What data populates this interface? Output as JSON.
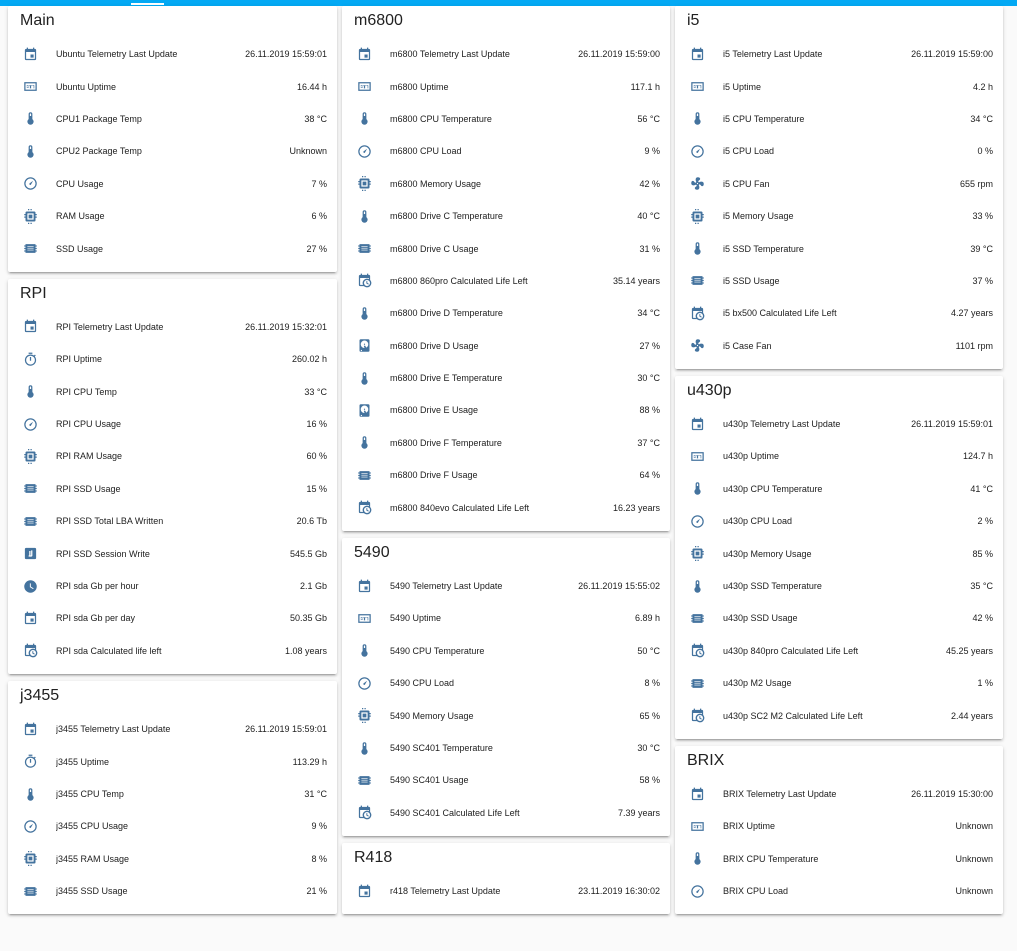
{
  "colors": {
    "accent": "#03a9f4",
    "icon": "#44739e"
  },
  "columns": [
    [
      {
        "title": "Main",
        "rows": [
          {
            "icon": "calendar",
            "label": "Ubuntu Telemetry Last Update",
            "value": "26.11.2019 15:59:01"
          },
          {
            "icon": "timer-box",
            "label": "Ubuntu Uptime",
            "value": "16.44 h"
          },
          {
            "icon": "thermometer",
            "label": "CPU1 Package Temp",
            "value": "38 °C"
          },
          {
            "icon": "thermometer",
            "label": "CPU2 Package Temp",
            "value": "Unknown"
          },
          {
            "icon": "gauge",
            "label": "CPU Usage",
            "value": "7 %"
          },
          {
            "icon": "chip",
            "label": "RAM Usage",
            "value": "6 %"
          },
          {
            "icon": "memory",
            "label": "SSD Usage",
            "value": "27 %"
          }
        ]
      },
      {
        "title": "RPI",
        "rows": [
          {
            "icon": "calendar",
            "label": "RPI Telemetry Last Update",
            "value": "26.11.2019 15:32:01"
          },
          {
            "icon": "timer",
            "label": "RPI Uptime",
            "value": "260.02 h"
          },
          {
            "icon": "thermometer",
            "label": "RPI CPU Temp",
            "value": "33 °C"
          },
          {
            "icon": "gauge",
            "label": "RPI CPU Usage",
            "value": "16 %"
          },
          {
            "icon": "chip",
            "label": "RPI RAM Usage",
            "value": "60 %"
          },
          {
            "icon": "memory",
            "label": "RPI SSD Usage",
            "value": "15 %"
          },
          {
            "icon": "memory",
            "label": "RPI SSD Total LBA Written",
            "value": "20.6 Tb"
          },
          {
            "icon": "alpha-w-box",
            "label": "RPI SSD Session Write",
            "value": "545.5 Gb"
          },
          {
            "icon": "clock",
            "label": "RPI sda Gb per hour",
            "value": "2.1 Gb"
          },
          {
            "icon": "calendar",
            "label": "RPI sda Gb per day",
            "value": "50.35 Gb"
          },
          {
            "icon": "calendar-clock",
            "label": "RPI sda Calculated life left",
            "value": "1.08 years"
          }
        ]
      },
      {
        "title": "j3455",
        "rows": [
          {
            "icon": "calendar",
            "label": "j3455 Telemetry Last Update",
            "value": "26.11.2019 15:59:01"
          },
          {
            "icon": "timer",
            "label": "j3455 Uptime",
            "value": "113.29 h"
          },
          {
            "icon": "thermometer",
            "label": "j3455 CPU Temp",
            "value": "31 °C"
          },
          {
            "icon": "gauge",
            "label": "j3455 CPU Usage",
            "value": "9 %"
          },
          {
            "icon": "chip",
            "label": "j3455 RAM Usage",
            "value": "8 %"
          },
          {
            "icon": "memory",
            "label": "j3455 SSD Usage",
            "value": "21 %"
          }
        ]
      }
    ],
    [
      {
        "title": "m6800",
        "rows": [
          {
            "icon": "calendar",
            "label": "m6800 Telemetry Last Update",
            "value": "26.11.2019 15:59:00"
          },
          {
            "icon": "timer-box",
            "label": "m6800 Uptime",
            "value": "117.1 h"
          },
          {
            "icon": "thermometer",
            "label": "m6800 CPU Temperature",
            "value": "56 °C"
          },
          {
            "icon": "gauge",
            "label": "m6800 CPU Load",
            "value": "9 %"
          },
          {
            "icon": "chip",
            "label": "m6800 Memory Usage",
            "value": "42 %"
          },
          {
            "icon": "thermometer",
            "label": "m6800 Drive C Temperature",
            "value": "40 °C"
          },
          {
            "icon": "memory",
            "label": "m6800 Drive C Usage",
            "value": "31 %"
          },
          {
            "icon": "calendar-clock",
            "label": "m6800 860pro Calculated Life Left",
            "value": "35.14 years"
          },
          {
            "icon": "thermometer",
            "label": "m6800 Drive D Temperature",
            "value": "34 °C"
          },
          {
            "icon": "harddisk",
            "label": "m6800 Drive D Usage",
            "value": "27 %"
          },
          {
            "icon": "thermometer",
            "label": "m6800 Drive E Temperature",
            "value": "30 °C"
          },
          {
            "icon": "harddisk",
            "label": "m6800 Drive E Usage",
            "value": "88 %"
          },
          {
            "icon": "thermometer",
            "label": "m6800 Drive F Temperature",
            "value": "37 °C"
          },
          {
            "icon": "memory",
            "label": "m6800 Drive F Usage",
            "value": "64 %"
          },
          {
            "icon": "calendar-clock",
            "label": "m6800 840evo Calculated Life Left",
            "value": "16.23 years"
          }
        ]
      },
      {
        "title": "5490",
        "rows": [
          {
            "icon": "calendar",
            "label": "5490 Telemetry Last Update",
            "value": "26.11.2019 15:55:02"
          },
          {
            "icon": "timer-box",
            "label": "5490 Uptime",
            "value": "6.89 h"
          },
          {
            "icon": "thermometer",
            "label": "5490 CPU Temperature",
            "value": "50 °C"
          },
          {
            "icon": "gauge",
            "label": "5490 CPU Load",
            "value": "8 %"
          },
          {
            "icon": "chip",
            "label": "5490 Memory Usage",
            "value": "65 %"
          },
          {
            "icon": "thermometer",
            "label": "5490 SC401 Temperature",
            "value": "30 °C"
          },
          {
            "icon": "memory",
            "label": "5490 SC401 Usage",
            "value": "58 %"
          },
          {
            "icon": "calendar-clock",
            "label": "5490 SC401 Calculated Life Left",
            "value": "7.39 years"
          }
        ]
      },
      {
        "title": "R418",
        "rows": [
          {
            "icon": "calendar",
            "label": "r418 Telemetry Last Update",
            "value": "23.11.2019 16:30:02"
          }
        ]
      }
    ],
    [
      {
        "title": "i5",
        "rows": [
          {
            "icon": "calendar",
            "label": "i5 Telemetry Last Update",
            "value": "26.11.2019 15:59:00"
          },
          {
            "icon": "timer-box",
            "label": "i5 Uptime",
            "value": "4.2 h"
          },
          {
            "icon": "thermometer",
            "label": "i5 CPU Temperature",
            "value": "34 °C"
          },
          {
            "icon": "gauge",
            "label": "i5 CPU Load",
            "value": "0 %"
          },
          {
            "icon": "fan",
            "label": "i5 CPU Fan",
            "value": "655 rpm"
          },
          {
            "icon": "chip",
            "label": "i5 Memory Usage",
            "value": "33 %"
          },
          {
            "icon": "thermometer",
            "label": "i5 SSD Temperature",
            "value": "39 °C"
          },
          {
            "icon": "memory",
            "label": "i5 SSD Usage",
            "value": "37 %"
          },
          {
            "icon": "calendar-clock",
            "label": "i5 bx500 Calculated Life Left",
            "value": "4.27 years"
          },
          {
            "icon": "fan",
            "label": "i5 Case Fan",
            "value": "1101 rpm"
          }
        ]
      },
      {
        "title": "u430p",
        "rows": [
          {
            "icon": "calendar",
            "label": "u430p Telemetry Last Update",
            "value": "26.11.2019 15:59:01"
          },
          {
            "icon": "timer-box",
            "label": "u430p Uptime",
            "value": "124.7 h"
          },
          {
            "icon": "thermometer",
            "label": "u430p CPU Temperature",
            "value": "41 °C"
          },
          {
            "icon": "gauge",
            "label": "u430p CPU Load",
            "value": "2 %"
          },
          {
            "icon": "chip",
            "label": "u430p Memory Usage",
            "value": "85 %"
          },
          {
            "icon": "thermometer",
            "label": "u430p SSD Temperature",
            "value": "35 °C"
          },
          {
            "icon": "memory",
            "label": "u430p SSD Usage",
            "value": "42 %"
          },
          {
            "icon": "calendar-clock",
            "label": "u430p 840pro Calculated Life Left",
            "value": "45.25 years"
          },
          {
            "icon": "memory",
            "label": "u430p M2 Usage",
            "value": "1 %"
          },
          {
            "icon": "calendar-clock",
            "label": "u430p SC2 M2 Calculated Life Left",
            "value": "2.44 years"
          }
        ]
      },
      {
        "title": "BRIX",
        "rows": [
          {
            "icon": "calendar",
            "label": "BRIX Telemetry Last Update",
            "value": "26.11.2019 15:30:00"
          },
          {
            "icon": "timer-box",
            "label": "BRIX Uptime",
            "value": "Unknown"
          },
          {
            "icon": "thermometer",
            "label": "BRIX CPU Temperature",
            "value": "Unknown"
          },
          {
            "icon": "gauge",
            "label": "BRIX CPU Load",
            "value": "Unknown"
          }
        ]
      }
    ]
  ]
}
